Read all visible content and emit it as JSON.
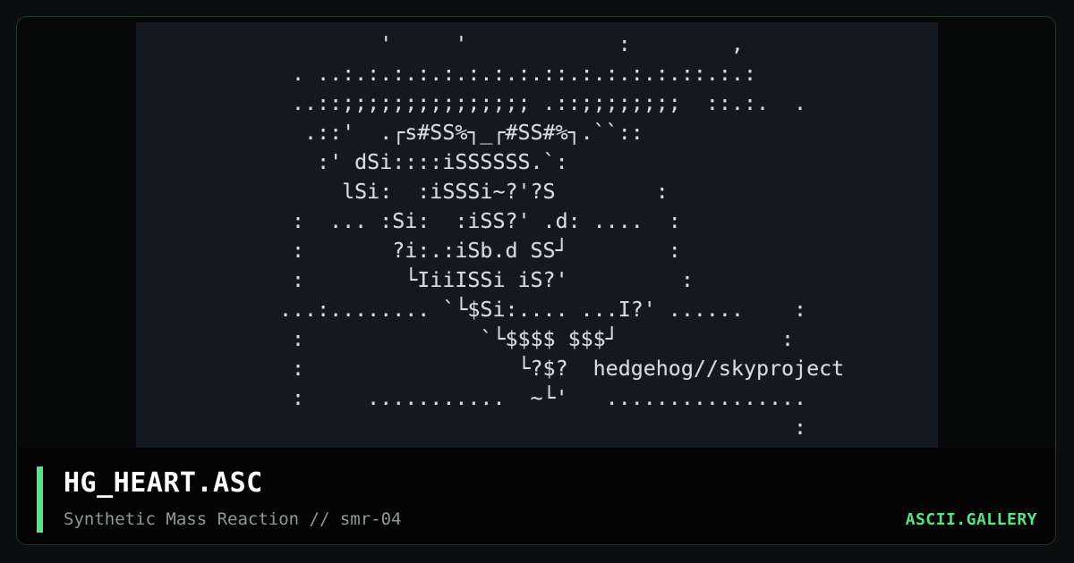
{
  "artwork": {
    "ascii": "        '     '            :        ,\n . ..:.:.:.:.:.:.:.:.::.:.:.:.:.::.:.:\n ..::;;;;;;;;;;;;;;; .::;;;;;;;;  ::.:.  .\n  .::'  .┌s#SS%┐_┌#SS#%┐.``:: \n   :' dSi::::iSSSSSS.`:\n     lSi:  :iSSSi~?'?S        :\n :  ... :Si:  :iSS?' .d: ....  :\n :       ?i:.:iSb.d SS┘        :\n :        └IiiISSi iS?'         :\n...:........ `└$Si:.... ...I?' ......    :\n :              `└$$$$ $$$┘             :\n :                 └?$?  hedgehog//skyproject\n :     ...........  ~└'   ................\n                                         :"
  },
  "card": {
    "title": "HG_HEART.ASC",
    "subtitle": "Synthetic Mass Reaction // smr-04",
    "brand": "ASCII.GALLERY"
  },
  "colors": {
    "accent": "#57e389",
    "background": "#0b0d0e",
    "panel": "#131821",
    "text": "#ffffff",
    "muted": "#8f9a94"
  }
}
